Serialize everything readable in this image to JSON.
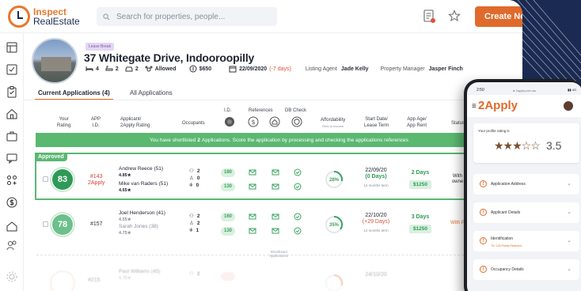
{
  "brand": {
    "line1": "Inspect",
    "line2": "RealEstate"
  },
  "search": {
    "placeholder": "Search for properties, people..."
  },
  "create_button": {
    "label": "Create New",
    "plus": "+"
  },
  "property": {
    "badge": "Lease Break",
    "address": "37 Whitegate Drive, Indooroopilly",
    "beds": "4",
    "baths": "2",
    "cars": "2",
    "pets": "Allowed",
    "rent": "$650",
    "date": "22/09/2020",
    "date_note": "(-7 days)",
    "listing_agent_label": "Listing Agent",
    "listing_agent": "Jade Kelly",
    "property_manager_label": "Property Manager",
    "property_manager": "Jasper Finch"
  },
  "tabs": {
    "current": "Current Applications (4)",
    "all": "All Applications"
  },
  "columns": {
    "rating": [
      "Your",
      "Rating"
    ],
    "app_id": [
      "APP",
      "I.D."
    ],
    "applicant": [
      "Applicant/",
      "2Apply Rating"
    ],
    "occupants": "Occupants",
    "id": "I.D.",
    "references": "References",
    "db_check": "DB Check",
    "affordability": "Affordability",
    "affordability_sub": "Rent to Income",
    "start": [
      "Start Date/",
      "Lease Term"
    ],
    "age": [
      "App Age/",
      "App Rent"
    ],
    "status": "Status"
  },
  "banner": {
    "pre": "You have shortlisted",
    "count": "2",
    "post": "Applications. Score the application by processing and checking the applications references"
  },
  "approved_label": "Approved",
  "rows": [
    {
      "rating": "83",
      "app_id": "#143",
      "app_sub": "2Apply",
      "applicant1": "Andrew Reece (51)",
      "stars1": "4.85★",
      "applicant2": "Mike van Raders (51)",
      "stars2": "4.65★",
      "occ": [
        "2",
        "0",
        "0"
      ],
      "id1": "180",
      "id2": "130",
      "afford": "28%",
      "afford_pct": 28,
      "start_date": "22/09/20",
      "start_note": "(0 Days)",
      "term": "12 months term",
      "age": "2 Days",
      "rent": "$1250",
      "status": [
        "With",
        "owne"
      ]
    },
    {
      "rating": "78",
      "app_id": "#157",
      "app_sub": "",
      "applicant1": "Joel Henderson (41)",
      "stars1": "4.55★",
      "applicant2": "Sarah Jones (38)",
      "stars2": "4.75★",
      "occ": [
        "2",
        "2",
        "1"
      ],
      "id1": "160",
      "id2": "130",
      "afford": "35%",
      "afford_pct": 35,
      "start_date": "22/10/20",
      "start_note": "(+29 Days)",
      "term": "12 months term",
      "age": "3 Days",
      "rent": "$1250",
      "status": [
        "With P",
        ""
      ]
    },
    {
      "rating": "",
      "app_id": "#215",
      "app_sub": "",
      "applicant1": "Paul Williams (45)",
      "stars1": "4.70★",
      "applicant2": "",
      "stars2": "",
      "occ": [
        "2",
        "",
        ""
      ],
      "id1": "",
      "id2": "",
      "afford": "",
      "afford_pct": 30,
      "start_date": "24/10/20",
      "start_note": "",
      "term": "",
      "age": "",
      "rent": "",
      "status": [
        "",
        ""
      ]
    }
  ],
  "shortlisted_label": [
    "Shortlisted",
    "Applications"
  ],
  "phone": {
    "time": "2:50",
    "url": "● 2apply.com.au",
    "signal": "▮▮ 4G",
    "brand": "2Apply",
    "rating_label": "Your profile rating is",
    "score": "3.5",
    "stars": "★★★☆☆",
    "items": [
      {
        "label": "Application Address",
        "sub": ""
      },
      {
        "label": "Applicant Details",
        "sub": ""
      },
      {
        "label": "Identification",
        "sub": "75 / 100 Points Received"
      },
      {
        "label": "Occupancy Details",
        "sub": ""
      }
    ]
  },
  "colors": {
    "accent": "#e06a2b",
    "green": "#2e9a57",
    "navy": "#1a2a52"
  }
}
